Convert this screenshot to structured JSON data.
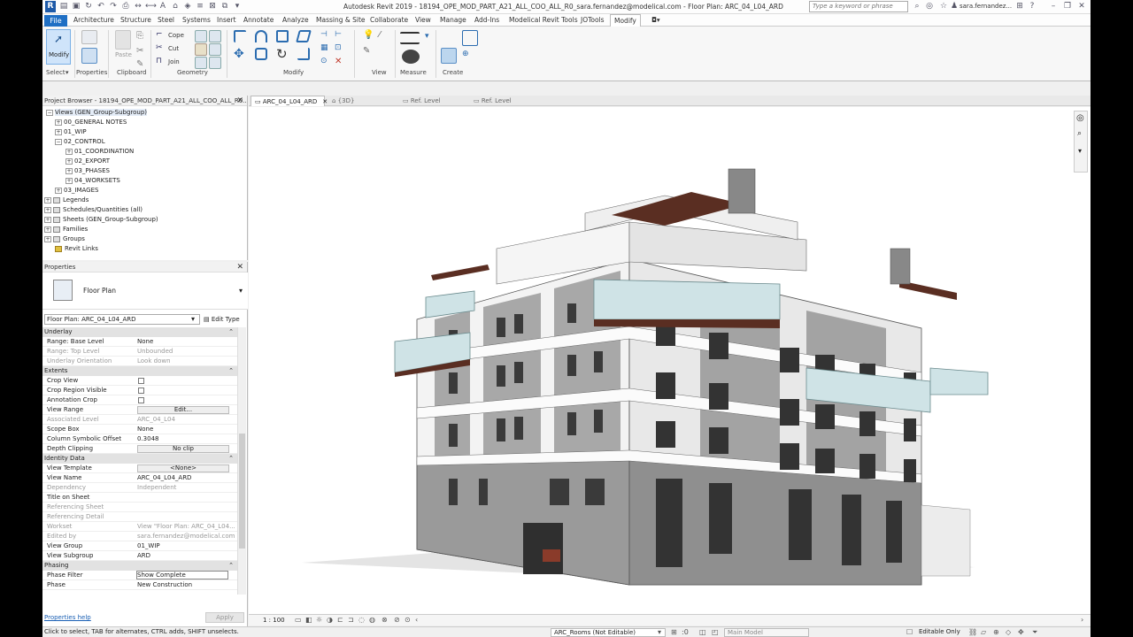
{
  "titlebar": {
    "title": "Autodesk Revit 2019 - 18194_OPE_MOD_PART_A21_ALL_COO_ALL_R0_sara.fernandez@modelical.com - Floor Plan: ARC_04_L04_ARD",
    "search_placeholder": "Type a keyword or phrase",
    "user": "sara.fernandez..."
  },
  "menu": {
    "file": "File",
    "tabs": [
      "Architecture",
      "Structure",
      "Steel",
      "Systems",
      "Insert",
      "Annotate",
      "Analyze",
      "Massing & Site",
      "Collaborate",
      "View",
      "Manage",
      "Add-Ins",
      "Modelical Revit Tools",
      "JOTools",
      "Modify"
    ]
  },
  "ribbon": {
    "select_label": "Select",
    "modify_label": "Modify",
    "properties_label": "Properties",
    "clipboard_label": "Clipboard",
    "paste_label": "Paste",
    "cope_label": "Cope",
    "cut_label": "Cut",
    "join_label": "Join",
    "geometry_label": "Geometry",
    "modify_panel_label": "Modify",
    "view_label": "View",
    "measure_label": "Measure",
    "create_label": "Create"
  },
  "project_browser": {
    "title": "Project Browser - 18194_OPE_MOD_PART_A21_ALL_COO_ALL_R0...",
    "items": [
      {
        "label": "Views (GEN_Group-Subgroup)",
        "expander": "−"
      },
      {
        "label": "00_GENERAL NOTES",
        "expander": "+"
      },
      {
        "label": "01_WIP",
        "expander": "+"
      },
      {
        "label": "02_CONTROL",
        "expander": "−"
      },
      {
        "label": "01_COORDINATION",
        "expander": "+"
      },
      {
        "label": "02_EXPORT",
        "expander": "+"
      },
      {
        "label": "03_PHASES",
        "expander": "+"
      },
      {
        "label": "04_WORKSETS",
        "expander": "+"
      },
      {
        "label": "03_IMAGES",
        "expander": "+"
      },
      {
        "label": "Legends",
        "expander": "+"
      },
      {
        "label": "Schedules/Quantities (all)",
        "expander": "+"
      },
      {
        "label": "Sheets (GEN_Group-Subgroup)",
        "expander": "+"
      },
      {
        "label": "Families",
        "expander": "+"
      },
      {
        "label": "Groups",
        "expander": "+"
      },
      {
        "label": "Revit Links",
        "expander": ""
      }
    ]
  },
  "properties": {
    "title": "Properties",
    "type_name": "Floor Plan",
    "instance": "Floor Plan: ARC_04_L04_ARD",
    "edit_type": "Edit Type",
    "groups": {
      "underlay": "Underlay",
      "extents": "Extents",
      "identity": "Identity Data",
      "phasing": "Phasing"
    },
    "rows": {
      "range_base_k": "Range: Base Level",
      "range_base_v": "None",
      "range_top_k": "Range: Top Level",
      "range_top_v": "Unbounded",
      "underlay_orient_k": "Underlay Orientation",
      "underlay_orient_v": "Look down",
      "crop_view_k": "Crop View",
      "crop_region_k": "Crop Region Visible",
      "annotation_crop_k": "Annotation Crop",
      "view_range_k": "View Range",
      "view_range_v": "Edit...",
      "assoc_level_k": "Associated Level",
      "assoc_level_v": "ARC_04_L04",
      "scope_box_k": "Scope Box",
      "scope_box_v": "None",
      "col_offset_k": "Column Symbolic Offset",
      "col_offset_v": "0.3048",
      "depth_clip_k": "Depth Clipping",
      "depth_clip_v": "No clip",
      "view_template_k": "View Template",
      "view_template_v": "<None>",
      "view_name_k": "View Name",
      "view_name_v": "ARC_04_L04_ARD",
      "dependency_k": "Dependency",
      "dependency_v": "Independent",
      "title_sheet_k": "Title on Sheet",
      "title_sheet_v": "",
      "ref_sheet_k": "Referencing Sheet",
      "ref_sheet_v": "",
      "ref_detail_k": "Referencing Detail",
      "ref_detail_v": "",
      "workset_k": "Workset",
      "workset_v": "View \"Floor Plan: ARC_04_L04...",
      "edited_by_k": "Edited by",
      "edited_by_v": "sara.fernandez@modelical.com",
      "view_group_k": "View Group",
      "view_group_v": "01_WIP",
      "view_subgroup_k": "View Subgroup",
      "view_subgroup_v": "ARD",
      "phase_filter_k": "Phase Filter",
      "phase_filter_v": "Show Complete",
      "phase_k": "Phase",
      "phase_v": "New Construction"
    },
    "help": "Properties help",
    "apply": "Apply"
  },
  "view_tabs": [
    "ARC_04_L04_ARD",
    "{3D}",
    "Ref. Level",
    "Ref. Level"
  ],
  "view_control": {
    "scale": "1 : 100"
  },
  "statusbar": {
    "hint": "Click to select, TAB for alternates, CTRL adds, SHIFT unselects.",
    "workset": "ARC_Rooms (Not Editable)",
    "design_option": "Main Model",
    "editable_only": "Editable Only",
    "selection_count": ":0"
  },
  "colors": {
    "file_tab": "#1f6fc4",
    "accent": "#cfe4fa",
    "facade_white": "#f4f4f4",
    "facade_grey": "#9a9a9a",
    "wood": "#5a2e22",
    "glass": "#cfe3e6"
  }
}
